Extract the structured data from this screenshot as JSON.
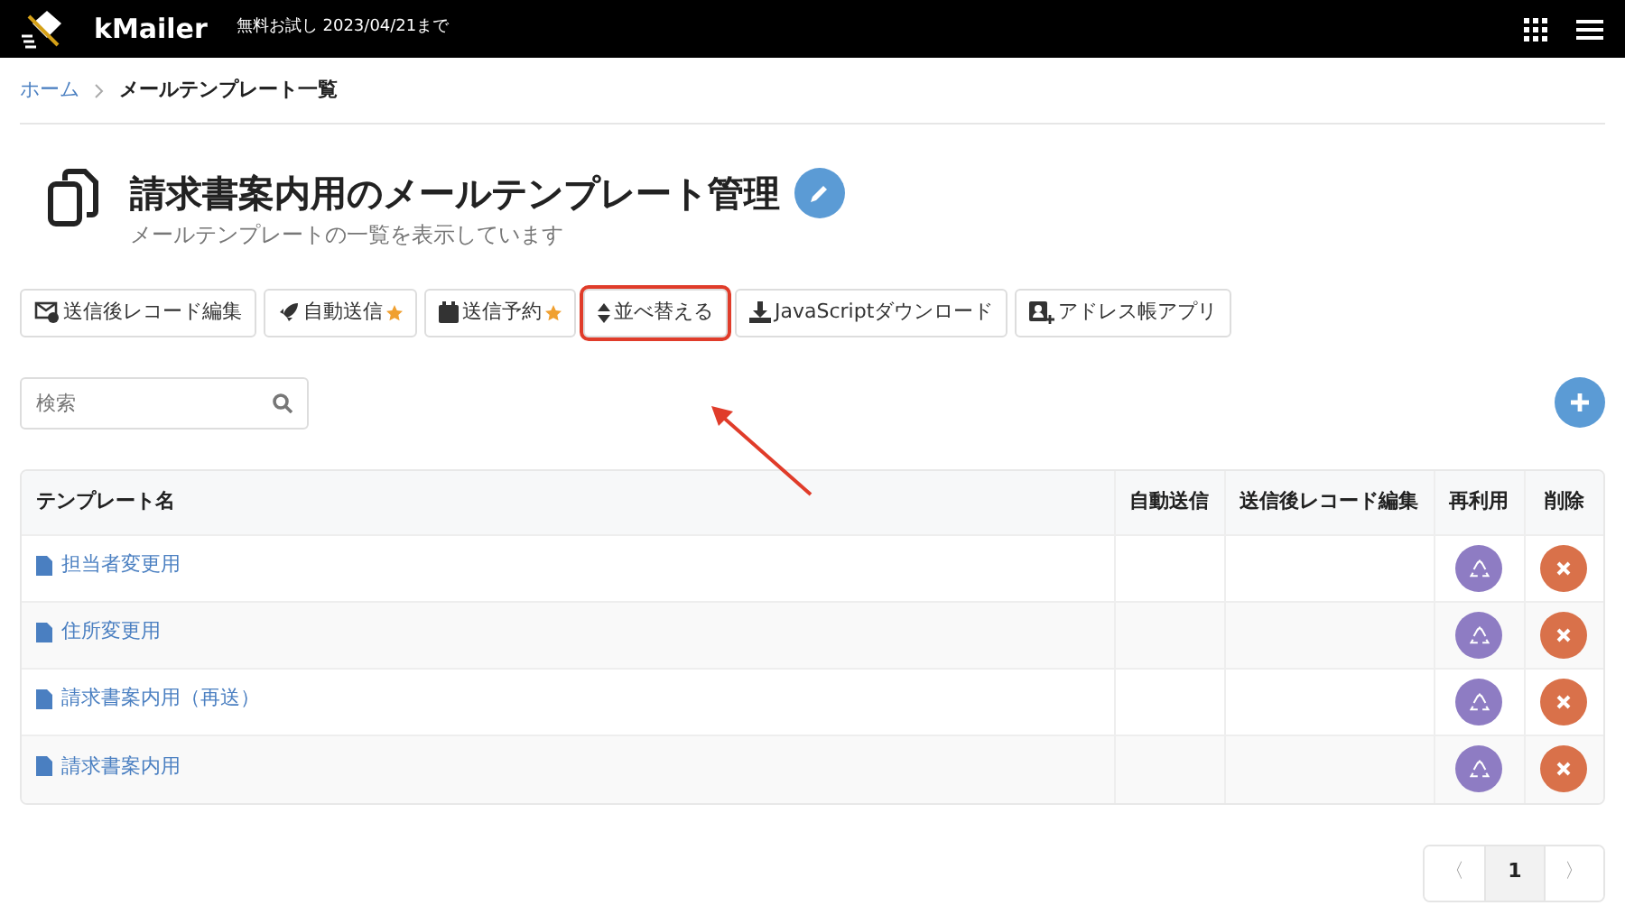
{
  "navbar": {
    "brand": "kMailer",
    "trial": "無料お試し 2023/04/21まで"
  },
  "breadcrumb": [
    {
      "label": "ホーム",
      "link": true
    },
    {
      "label": "メールテンプレート一覧",
      "link": false
    }
  ],
  "page": {
    "title": "請求書案内用のメールテンプレート管理",
    "subtitle": "メールテンプレートの一覧を表示しています"
  },
  "toolbar": [
    {
      "label": "送信後レコード編集",
      "starred": false,
      "highlighted": false
    },
    {
      "label": "自動送信",
      "starred": true,
      "highlighted": false
    },
    {
      "label": "送信予約",
      "starred": true,
      "highlighted": false
    },
    {
      "label": "並べ替える",
      "starred": false,
      "highlighted": true
    },
    {
      "label": "JavaScriptダウンロード",
      "starred": false,
      "highlighted": false
    },
    {
      "label": "アドレス帳アプリ",
      "starred": false,
      "highlighted": false
    }
  ],
  "search": {
    "placeholder": "検索"
  },
  "table": {
    "columns": [
      "テンプレート名",
      "自動送信",
      "送信後レコード編集",
      "再利用",
      "削除"
    ],
    "rows": [
      {
        "name": "担当者変更用"
      },
      {
        "name": "住所変更用"
      },
      {
        "name": "請求書案内用（再送）"
      },
      {
        "name": "請求書案内用"
      }
    ]
  },
  "pagination": [
    {
      "label": "〈",
      "selected": false
    },
    {
      "label": "1",
      "selected": true
    },
    {
      "label": "〉",
      "selected": false
    }
  ]
}
